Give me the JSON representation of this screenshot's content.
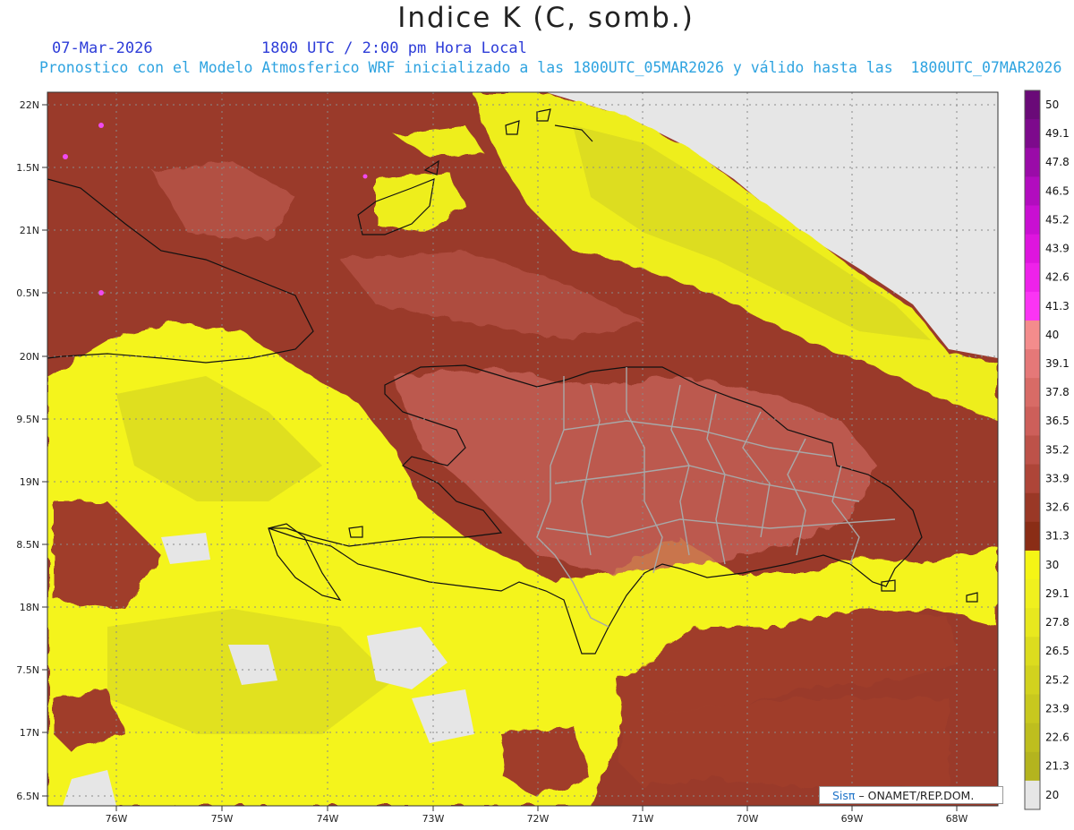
{
  "title": "Indice K (C, somb.)",
  "date": "07-Mar-2026",
  "time": "1800 UTC / 2:00 pm Hora Local",
  "subtitle": "Pronostico con el Modelo Atmosferico WRF inicializado a las 1800UTC_05MAR2026 y válido hasta las  1800UTC_07MAR2026",
  "credit": {
    "brand": "Sisπ",
    "org": "– ONAMET/REP.DOM."
  },
  "lat_labels": [
    "22N",
    "1.5N",
    "21N",
    "0.5N",
    "20N",
    "9.5N",
    "19N",
    "8.5N",
    "18N",
    "7.5N",
    "17N",
    "6.5N"
  ],
  "lon_labels": [
    "76W",
    "75W",
    "74W",
    "73W",
    "72W",
    "71W",
    "70W",
    "69W",
    "68W"
  ],
  "colorbar": {
    "levels": [
      "50",
      "49.1",
      "47.8",
      "46.5",
      "45.2",
      "43.9",
      "42.6",
      "41.3",
      "40",
      "39.1",
      "37.8",
      "36.5",
      "35.2",
      "33.9",
      "32.6",
      "31.3",
      "30",
      "29.1",
      "27.8",
      "26.5",
      "25.2",
      "23.9",
      "22.6",
      "21.3",
      "20"
    ],
    "colors": [
      "#6a0a78",
      "#7d0a8c",
      "#9a0ba8",
      "#b20cbf",
      "#c90fd2",
      "#de15de",
      "#ee22ea",
      "#fb34f4",
      "#f48c8c",
      "#e57878",
      "#d86b66",
      "#cd5f5a",
      "#bd5249",
      "#ae4538",
      "#9a3826",
      "#8a2d16",
      "#f5f515",
      "#f0f01e",
      "#e8e81e",
      "#dcdc1e",
      "#d2d21e",
      "#c8c81e",
      "#bebe1e",
      "#b4b41e",
      "#e6e6e6"
    ]
  },
  "colors": {
    "ocean_bg": "#9a3a2a",
    "low_yellow": "#f4f41b",
    "mid_yellow": "#dada22",
    "grey_none": "#e6e6e6",
    "high_red": "#c25e55",
    "coast": "#111111",
    "province": "#a8a8a8"
  }
}
